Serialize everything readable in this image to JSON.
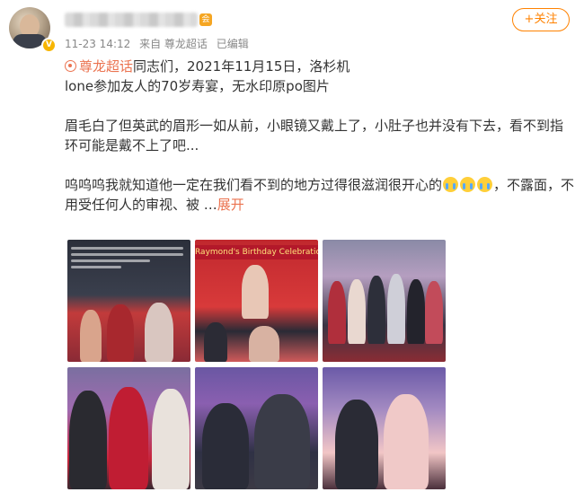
{
  "header": {
    "time": "11-23 14:12",
    "source": "来自 尊龙超话",
    "edited": "已编辑",
    "follow_label": "+关注",
    "verified_badge": "V",
    "vip_badge": "会"
  },
  "post": {
    "topic": "尊龙超话",
    "line1_rest": "同志们，2021年11月15日，洛杉机",
    "line2": "lone参加友人的70岁寿宴，无水印原po图片",
    "para2": "眉毛白了但英武的眉形一如从前，小眼镜又戴上了，小肚子也并没有下去，看不到指环可能是戴不上了吧...",
    "para3_a": "呜呜呜我就知道他一定在我们看不到的地方过得很滋润很开心的",
    "para3_b": "，不露面，不用受任何人的审视、被 …",
    "expand_label": "展开"
  },
  "images": {
    "thumb2_banner": "Raymond's Birthday Celebration"
  },
  "colors": {
    "link": "#eb7350",
    "follow": "#ff8200",
    "meta": "#888888"
  }
}
